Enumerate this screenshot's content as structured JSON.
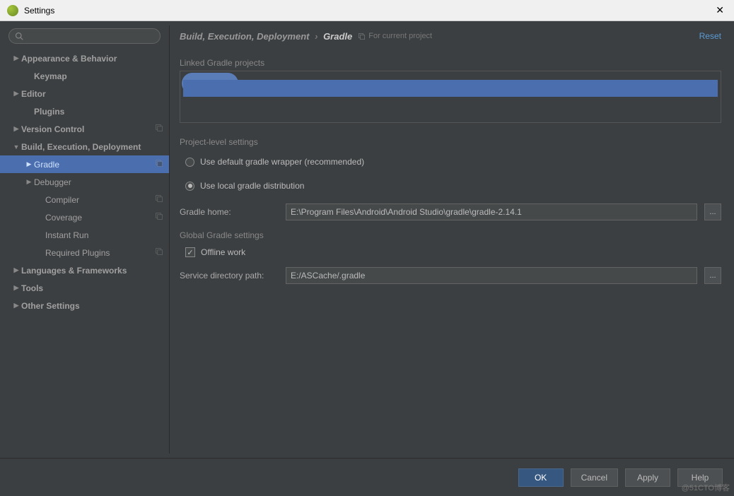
{
  "window": {
    "title": "Settings"
  },
  "sidebar": {
    "search_placeholder": "",
    "items": [
      {
        "label": "Appearance & Behavior",
        "arrow": "▶",
        "indent": 1,
        "bold": true
      },
      {
        "label": "Keymap",
        "arrow": "",
        "indent": 2,
        "bold": true
      },
      {
        "label": "Editor",
        "arrow": "▶",
        "indent": 1,
        "bold": true
      },
      {
        "label": "Plugins",
        "arrow": "",
        "indent": 2,
        "bold": true
      },
      {
        "label": "Version Control",
        "arrow": "▶",
        "indent": 1,
        "bold": true,
        "copy": true
      },
      {
        "label": "Build, Execution, Deployment",
        "arrow": "▼",
        "indent": 1,
        "bold": true
      },
      {
        "label": "Gradle",
        "arrow": "▶",
        "indent": 2,
        "selected": true,
        "copy": true
      },
      {
        "label": "Debugger",
        "arrow": "▶",
        "indent": 2
      },
      {
        "label": "Compiler",
        "arrow": "",
        "indent": 3,
        "copy": true
      },
      {
        "label": "Coverage",
        "arrow": "",
        "indent": 3,
        "copy": true
      },
      {
        "label": "Instant Run",
        "arrow": "",
        "indent": 3
      },
      {
        "label": "Required Plugins",
        "arrow": "",
        "indent": 3,
        "copy": true
      },
      {
        "label": "Languages & Frameworks",
        "arrow": "▶",
        "indent": 1,
        "bold": true
      },
      {
        "label": "Tools",
        "arrow": "▶",
        "indent": 1,
        "bold": true
      },
      {
        "label": "Other Settings",
        "arrow": "▶",
        "indent": 1,
        "bold": true
      }
    ]
  },
  "breadcrumb": {
    "parent": "Build, Execution, Deployment",
    "sep": "›",
    "current": "Gradle",
    "scope": "For current project"
  },
  "reset": "Reset",
  "sections": {
    "linked": "Linked Gradle projects",
    "project": "Project-level settings",
    "global": "Global Gradle settings"
  },
  "radios": {
    "default_wrapper": "Use default gradle wrapper (recommended)",
    "local_dist": "Use local gradle distribution"
  },
  "fields": {
    "gradle_home_label": "Gradle home:",
    "gradle_home_value": "E:\\Program Files\\Android\\Android Studio\\gradle\\gradle-2.14.1",
    "offline_work": "Offline work",
    "service_dir_label": "Service directory path:",
    "service_dir_value": "E:/ASCache/.gradle",
    "browse": "..."
  },
  "buttons": {
    "ok": "OK",
    "cancel": "Cancel",
    "apply": "Apply",
    "help": "Help"
  },
  "watermark": "@51CTO博客"
}
